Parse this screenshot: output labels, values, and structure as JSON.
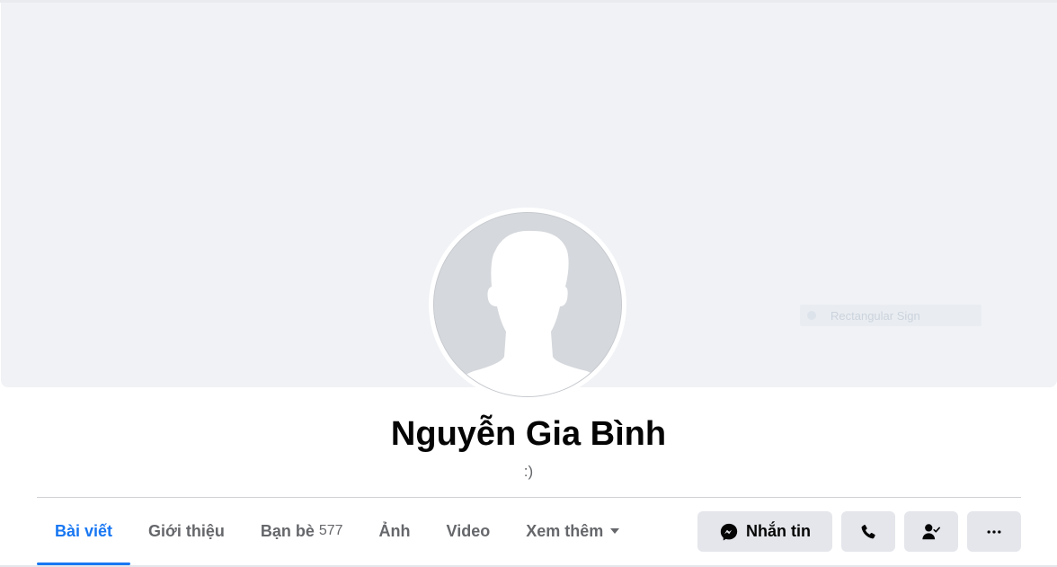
{
  "profile": {
    "name": "Nguyễn Gia Bình",
    "bio": ":)"
  },
  "cover": {
    "alt_text": "Rectangular Sign"
  },
  "tabs": [
    {
      "label": "Bài viết",
      "active": true
    },
    {
      "label": "Giới thiệu",
      "active": false
    },
    {
      "label": "Bạn bè",
      "count": "577",
      "active": false
    },
    {
      "label": "Ảnh",
      "active": false
    },
    {
      "label": "Video",
      "active": false
    },
    {
      "label": "Xem thêm",
      "active": false
    }
  ],
  "actions": {
    "message_label": "Nhắn tin",
    "message_icon": "messenger-icon",
    "call_icon": "phone-icon",
    "friend_icon": "friend-check-icon",
    "more_icon": "ellipsis-icon"
  },
  "colors": {
    "accent": "#1877f2",
    "cover_bg": "#f0f2f5",
    "button_bg": "#e4e6eb",
    "tab_text": "#65676b"
  }
}
